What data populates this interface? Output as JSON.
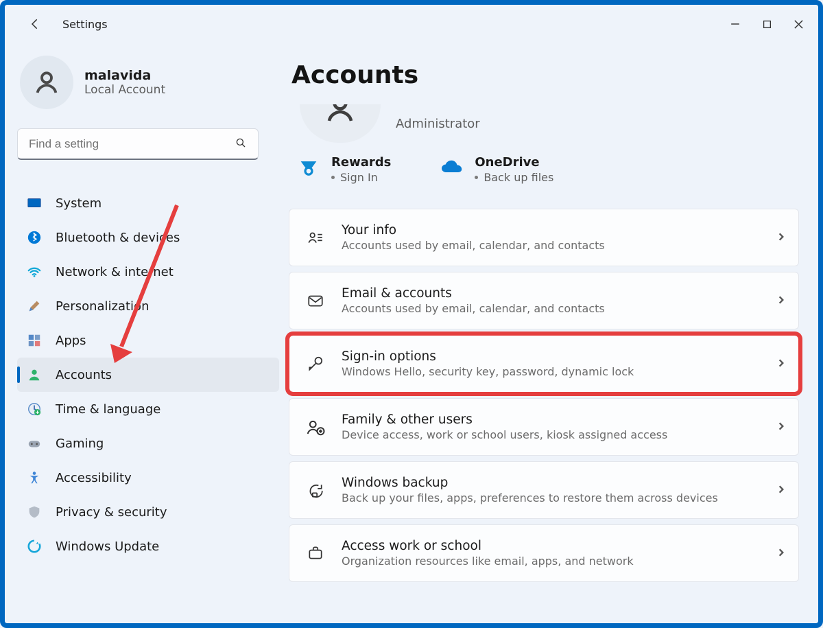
{
  "titlebar": {
    "title": "Settings"
  },
  "user": {
    "name": "malavida",
    "subtitle": "Local Account"
  },
  "search": {
    "placeholder": "Find a setting"
  },
  "nav": {
    "items": [
      {
        "label": "System"
      },
      {
        "label": "Bluetooth & devices"
      },
      {
        "label": "Network & internet"
      },
      {
        "label": "Personalization"
      },
      {
        "label": "Apps"
      },
      {
        "label": "Accounts"
      },
      {
        "label": "Time & language"
      },
      {
        "label": "Gaming"
      },
      {
        "label": "Accessibility"
      },
      {
        "label": "Privacy & security"
      },
      {
        "label": "Windows Update"
      }
    ]
  },
  "main": {
    "page_title": "Accounts",
    "profile_role": "Administrator",
    "rewards": {
      "title": "Rewards",
      "sub": "Sign In"
    },
    "onedrive": {
      "title": "OneDrive",
      "sub": "Back up files"
    },
    "cards": [
      {
        "title": "Your info",
        "sub": "Accounts used by email, calendar, and contacts"
      },
      {
        "title": "Email & accounts",
        "sub": "Accounts used by email, calendar, and contacts"
      },
      {
        "title": "Sign-in options",
        "sub": "Windows Hello, security key, password, dynamic lock"
      },
      {
        "title": "Family & other users",
        "sub": "Device access, work or school users, kiosk assigned access"
      },
      {
        "title": "Windows backup",
        "sub": "Back up your files, apps, preferences to restore them across devices"
      },
      {
        "title": "Access work or school",
        "sub": "Organization resources like email, apps, and network"
      }
    ]
  }
}
